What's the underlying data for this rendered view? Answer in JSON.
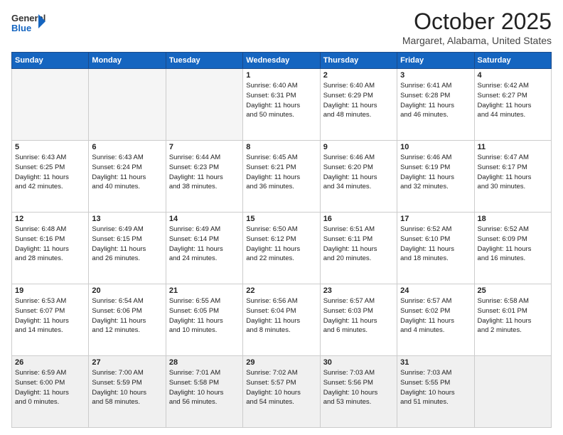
{
  "header": {
    "logo_general": "General",
    "logo_blue": "Blue",
    "month": "October 2025",
    "location": "Margaret, Alabama, United States"
  },
  "weekdays": [
    "Sunday",
    "Monday",
    "Tuesday",
    "Wednesday",
    "Thursday",
    "Friday",
    "Saturday"
  ],
  "weeks": [
    [
      {
        "day": "",
        "info": ""
      },
      {
        "day": "",
        "info": ""
      },
      {
        "day": "",
        "info": ""
      },
      {
        "day": "1",
        "info": "Sunrise: 6:40 AM\nSunset: 6:31 PM\nDaylight: 11 hours\nand 50 minutes."
      },
      {
        "day": "2",
        "info": "Sunrise: 6:40 AM\nSunset: 6:29 PM\nDaylight: 11 hours\nand 48 minutes."
      },
      {
        "day": "3",
        "info": "Sunrise: 6:41 AM\nSunset: 6:28 PM\nDaylight: 11 hours\nand 46 minutes."
      },
      {
        "day": "4",
        "info": "Sunrise: 6:42 AM\nSunset: 6:27 PM\nDaylight: 11 hours\nand 44 minutes."
      }
    ],
    [
      {
        "day": "5",
        "info": "Sunrise: 6:43 AM\nSunset: 6:25 PM\nDaylight: 11 hours\nand 42 minutes."
      },
      {
        "day": "6",
        "info": "Sunrise: 6:43 AM\nSunset: 6:24 PM\nDaylight: 11 hours\nand 40 minutes."
      },
      {
        "day": "7",
        "info": "Sunrise: 6:44 AM\nSunset: 6:23 PM\nDaylight: 11 hours\nand 38 minutes."
      },
      {
        "day": "8",
        "info": "Sunrise: 6:45 AM\nSunset: 6:21 PM\nDaylight: 11 hours\nand 36 minutes."
      },
      {
        "day": "9",
        "info": "Sunrise: 6:46 AM\nSunset: 6:20 PM\nDaylight: 11 hours\nand 34 minutes."
      },
      {
        "day": "10",
        "info": "Sunrise: 6:46 AM\nSunset: 6:19 PM\nDaylight: 11 hours\nand 32 minutes."
      },
      {
        "day": "11",
        "info": "Sunrise: 6:47 AM\nSunset: 6:17 PM\nDaylight: 11 hours\nand 30 minutes."
      }
    ],
    [
      {
        "day": "12",
        "info": "Sunrise: 6:48 AM\nSunset: 6:16 PM\nDaylight: 11 hours\nand 28 minutes."
      },
      {
        "day": "13",
        "info": "Sunrise: 6:49 AM\nSunset: 6:15 PM\nDaylight: 11 hours\nand 26 minutes."
      },
      {
        "day": "14",
        "info": "Sunrise: 6:49 AM\nSunset: 6:14 PM\nDaylight: 11 hours\nand 24 minutes."
      },
      {
        "day": "15",
        "info": "Sunrise: 6:50 AM\nSunset: 6:12 PM\nDaylight: 11 hours\nand 22 minutes."
      },
      {
        "day": "16",
        "info": "Sunrise: 6:51 AM\nSunset: 6:11 PM\nDaylight: 11 hours\nand 20 minutes."
      },
      {
        "day": "17",
        "info": "Sunrise: 6:52 AM\nSunset: 6:10 PM\nDaylight: 11 hours\nand 18 minutes."
      },
      {
        "day": "18",
        "info": "Sunrise: 6:52 AM\nSunset: 6:09 PM\nDaylight: 11 hours\nand 16 minutes."
      }
    ],
    [
      {
        "day": "19",
        "info": "Sunrise: 6:53 AM\nSunset: 6:07 PM\nDaylight: 11 hours\nand 14 minutes."
      },
      {
        "day": "20",
        "info": "Sunrise: 6:54 AM\nSunset: 6:06 PM\nDaylight: 11 hours\nand 12 minutes."
      },
      {
        "day": "21",
        "info": "Sunrise: 6:55 AM\nSunset: 6:05 PM\nDaylight: 11 hours\nand 10 minutes."
      },
      {
        "day": "22",
        "info": "Sunrise: 6:56 AM\nSunset: 6:04 PM\nDaylight: 11 hours\nand 8 minutes."
      },
      {
        "day": "23",
        "info": "Sunrise: 6:57 AM\nSunset: 6:03 PM\nDaylight: 11 hours\nand 6 minutes."
      },
      {
        "day": "24",
        "info": "Sunrise: 6:57 AM\nSunset: 6:02 PM\nDaylight: 11 hours\nand 4 minutes."
      },
      {
        "day": "25",
        "info": "Sunrise: 6:58 AM\nSunset: 6:01 PM\nDaylight: 11 hours\nand 2 minutes."
      }
    ],
    [
      {
        "day": "26",
        "info": "Sunrise: 6:59 AM\nSunset: 6:00 PM\nDaylight: 11 hours\nand 0 minutes."
      },
      {
        "day": "27",
        "info": "Sunrise: 7:00 AM\nSunset: 5:59 PM\nDaylight: 10 hours\nand 58 minutes."
      },
      {
        "day": "28",
        "info": "Sunrise: 7:01 AM\nSunset: 5:58 PM\nDaylight: 10 hours\nand 56 minutes."
      },
      {
        "day": "29",
        "info": "Sunrise: 7:02 AM\nSunset: 5:57 PM\nDaylight: 10 hours\nand 54 minutes."
      },
      {
        "day": "30",
        "info": "Sunrise: 7:03 AM\nSunset: 5:56 PM\nDaylight: 10 hours\nand 53 minutes."
      },
      {
        "day": "31",
        "info": "Sunrise: 7:03 AM\nSunset: 5:55 PM\nDaylight: 10 hours\nand 51 minutes."
      },
      {
        "day": "",
        "info": ""
      }
    ]
  ]
}
